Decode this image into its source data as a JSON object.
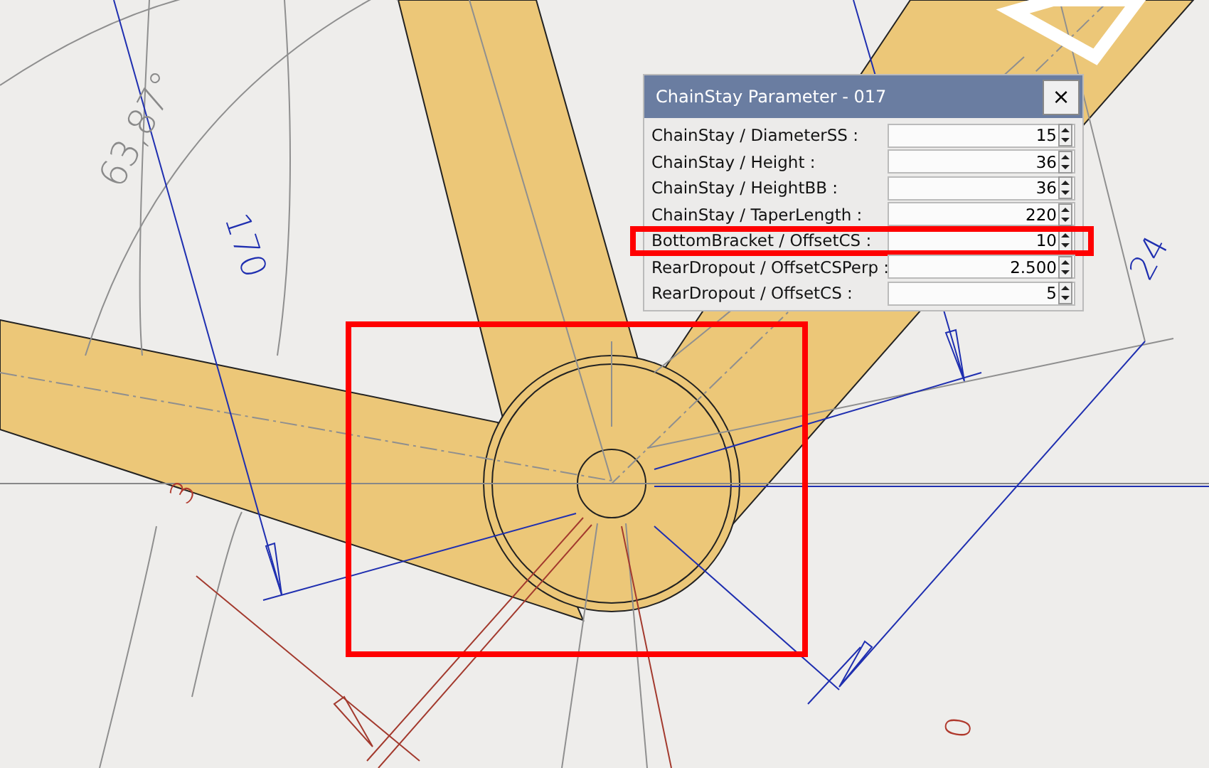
{
  "drawing": {
    "dimension_labels": [
      {
        "text": "63,87°",
        "color": "#8a8a8a"
      },
      {
        "text": "170",
        "color": "#1f2fb0"
      },
      {
        "text": "3",
        "color": "#b03a2e"
      },
      {
        "text": "24",
        "color": "#1f2fb0"
      },
      {
        "text": "0",
        "color": "#b03a2e"
      }
    ]
  },
  "dialog": {
    "title": "ChainStay Parameter - 017",
    "close": "×",
    "rows": [
      {
        "label": "ChainStay / DiameterSS :",
        "value": "15",
        "highlighted": false
      },
      {
        "label": "ChainStay / Height :",
        "value": "36",
        "highlighted": false
      },
      {
        "label": "ChainStay / HeightBB :",
        "value": "36",
        "highlighted": false
      },
      {
        "label": "ChainStay / TaperLength :",
        "value": "220",
        "highlighted": false
      },
      {
        "label": "BottomBracket / OffsetCS :",
        "value": "10",
        "highlighted": true
      },
      {
        "label": "RearDropout / OffsetCSPerp :",
        "value": "2.500",
        "highlighted": false
      },
      {
        "label": "RearDropout / OffsetCS :",
        "value": "5",
        "highlighted": false
      }
    ]
  }
}
